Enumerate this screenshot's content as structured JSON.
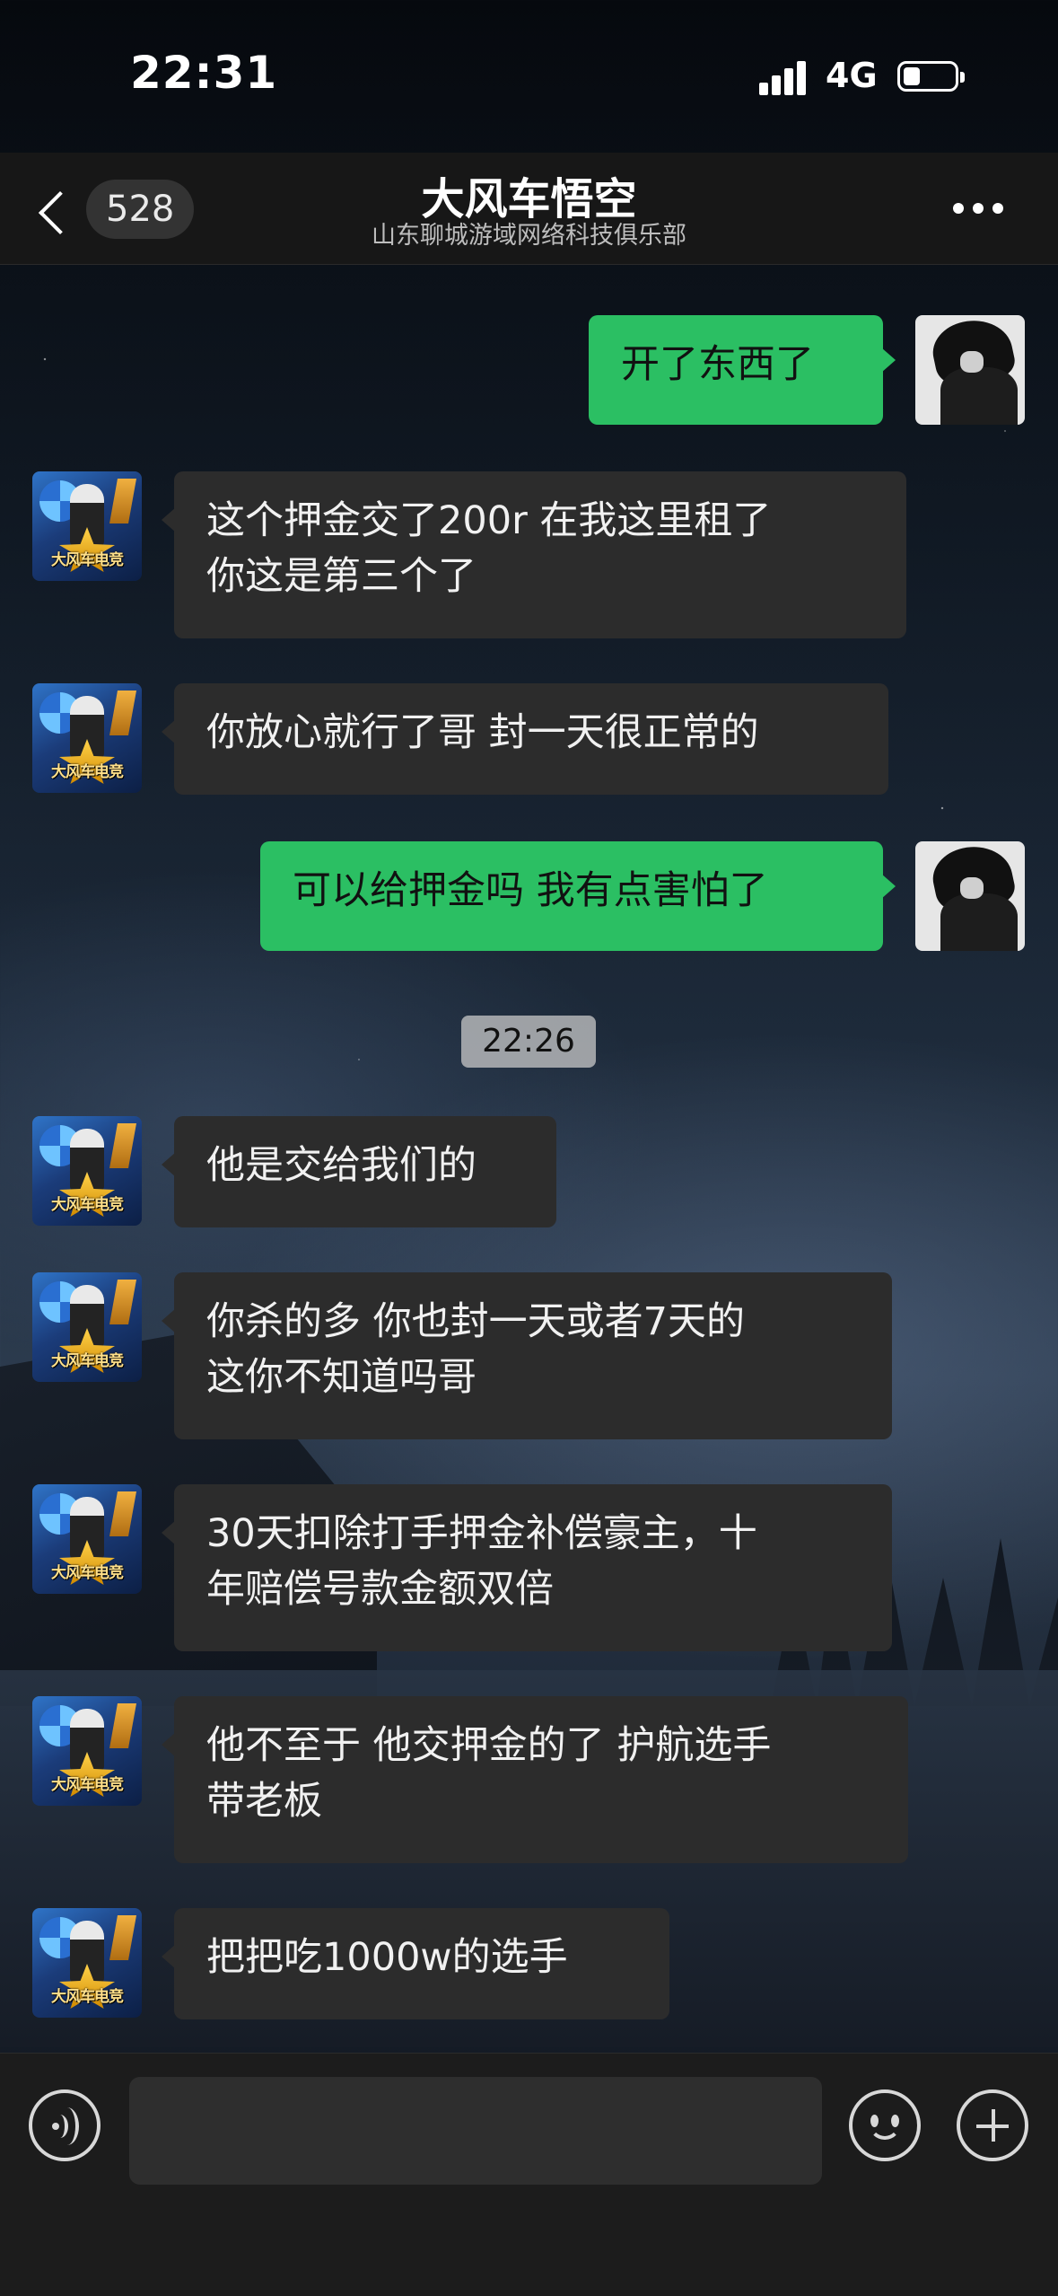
{
  "status_bar": {
    "time": "22:31",
    "network": "4G"
  },
  "header": {
    "unread_count": "528",
    "title": "大风车悟空",
    "subtitle": "山东聊城游域网络科技俱乐部"
  },
  "peer_avatar_text": "大风车电竞",
  "messages": [
    {
      "from": "me",
      "text": "开了东西了"
    },
    {
      "from": "peer",
      "text": "这个押金交了200r 在我这里租了\n你这是第三个了"
    },
    {
      "from": "peer",
      "text": "你放心就行了哥 封一天很正常的"
    },
    {
      "from": "me",
      "text": "可以给押金吗 我有点害怕了"
    },
    {
      "from": "peer",
      "text": "他是交给我们的"
    },
    {
      "from": "peer",
      "text": "你杀的多 你也封一天或者7天的\n这你不知道吗哥"
    },
    {
      "from": "peer",
      "text": "30天扣除打手押金补偿豪主，十\n年赔偿号款金额双倍"
    },
    {
      "from": "peer",
      "text": "他不至于 他交押金的了 护航选手\n带老板"
    },
    {
      "from": "peer",
      "text": "把把吃1000w的选手"
    }
  ],
  "time_separator": "22:26",
  "input": {
    "value": "",
    "placeholder": ""
  },
  "colors": {
    "my_bubble": "#2bbf63",
    "peer_bubble": "#2c2c2c",
    "nav_bg": "#171717"
  }
}
